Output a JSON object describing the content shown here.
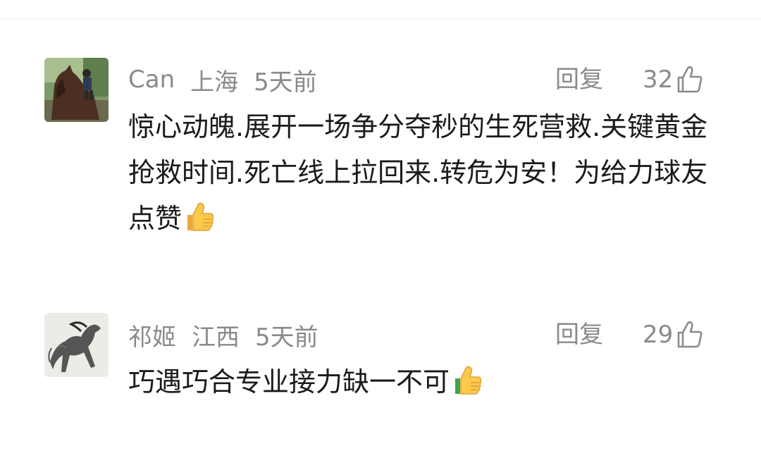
{
  "comments": [
    {
      "user": "Can",
      "location": "上海",
      "time": "5天前",
      "reply_label": "回复",
      "likes": "32",
      "text": "惊心动魄.展开一场争分夺秒的生死营救.关键黄金抢救时间.死亡线上拉回来.转危为安！为给力球友点赞",
      "avatar_icon": "horse-rider-photo",
      "like_icon": "thumbs-up-outline-icon",
      "emoji_icon": "thumbs-up-emoji"
    },
    {
      "user": "祁姬",
      "location": "江西",
      "time": "5天前",
      "reply_label": "回复",
      "likes": "29",
      "text": "巧遇巧合专业接力缺一不可",
      "avatar_icon": "ink-horse-painting",
      "like_icon": "thumbs-up-outline-icon",
      "emoji_icon": "thumbs-up-emoji"
    }
  ],
  "colors": {
    "meta_text": "#8a8a8a",
    "body_text": "#1b1b1b",
    "background": "#ffffff"
  }
}
